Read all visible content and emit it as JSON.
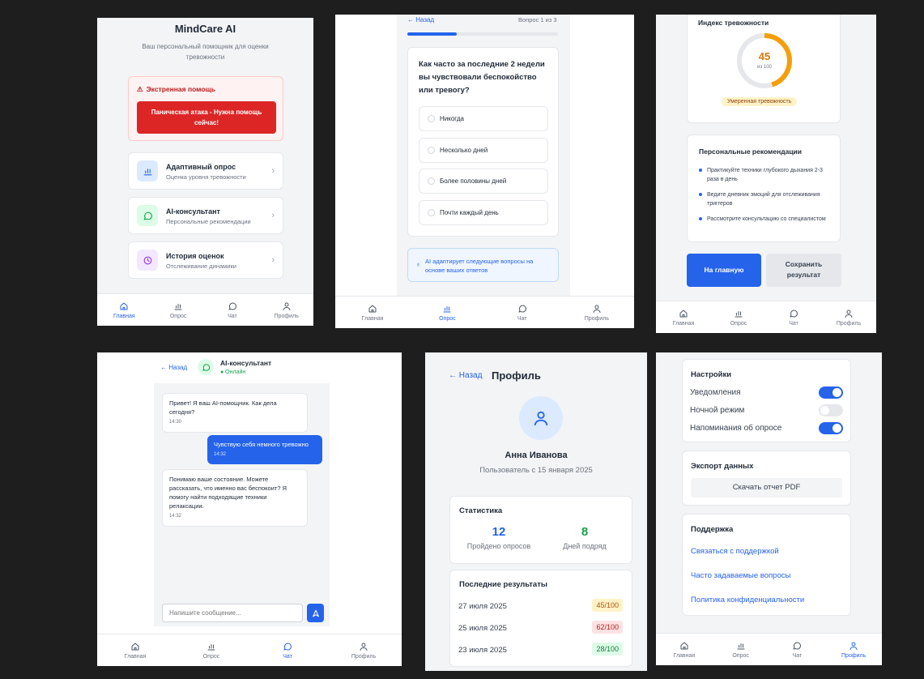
{
  "nav": [
    "Главная",
    "Опрос",
    "Чат",
    "Профиль"
  ],
  "home": {
    "title": "MindCare AI",
    "subtitle": "Ваш персональный помощник для оценки тревожности",
    "emergency_title": "Экстренная помощь",
    "emergency_button": "Паническая атака - Нужна помощь сейчас!",
    "menu": [
      {
        "title": "Адаптивный опрос",
        "sub": "Оценка уровня тревожности",
        "icon": "bar-chart-icon"
      },
      {
        "title": "AI-консультант",
        "sub": "Персональные рекомендации",
        "icon": "chat-icon"
      },
      {
        "title": "История оценок",
        "sub": "Отслеживание динамики",
        "icon": "clock-icon"
      }
    ]
  },
  "survey": {
    "back": "← Назад",
    "counter": "Вопрос 1 из 3",
    "progress": 0.33,
    "question": "Как часто за последние 2 недели вы чувствовали беспокойство или тревогу?",
    "options": [
      "Никогда",
      "Несколько дней",
      "Более половины дней",
      "Почти каждый день"
    ],
    "ai_note": "AI адаптирует следующие вопросы на основе ваших ответов"
  },
  "results": {
    "index_title": "Индекс тревожности",
    "score": "45",
    "score_max": "из 100",
    "score_fraction": 0.45,
    "level": "Умеренная тревожность",
    "rec_title": "Персональные рекомендации",
    "recommendations": [
      "Практикуйте техники глубокого дыхания 2-3 раза в день",
      "Ведите дневник эмоций для отслеживания триггеров",
      "Рассмотрите консультацию со специалистом"
    ],
    "home_button": "На главную",
    "save_button": "Сохранить результат"
  },
  "chat": {
    "back": "← Назад",
    "title": "AI-консультант",
    "status": "● Онлайн",
    "messages": [
      {
        "text": "Привет! Я ваш AI-помощник. Как дела сегодня?",
        "time": "14:30"
      },
      {
        "text": "Чувствую себя немного тревожно",
        "time": "14:32"
      },
      {
        "text": "Понимаю ваше состояние. Можете рассказать, что именно вас беспокоит? Я помогу найти подходящие техники релаксации.",
        "time": "14:32"
      }
    ],
    "input_placeholder": "Напишите сообщение..."
  },
  "profile": {
    "back": "← Назад",
    "title": "Профиль",
    "name": "Анна Иванова",
    "since": "Пользователь с 15 января 2025",
    "stats_title": "Статистика",
    "stat1_value": "12",
    "stat1_label": "Пройдено опросов",
    "stat2_value": "8",
    "stat2_label": "Дней подряд",
    "recent_title": "Последние результаты",
    "recent": [
      {
        "date": "27 июля 2025",
        "score": "45/100",
        "color": "#fef3c7",
        "text": "#b45309"
      },
      {
        "date": "25 июля 2025",
        "score": "62/100",
        "color": "#fee2e2",
        "text": "#b91c1c"
      },
      {
        "date": "23 июля 2025",
        "score": "28/100",
        "color": "#dcfce7",
        "text": "#15803d"
      }
    ]
  },
  "settings": {
    "title": "Настройки",
    "toggles": [
      {
        "label": "Уведомления",
        "on": true
      },
      {
        "label": "Ночной режим",
        "on": false
      },
      {
        "label": "Напоминания об опросе",
        "on": true
      }
    ],
    "export_title": "Экспорт данных",
    "export_button": "Скачать отчет PDF",
    "support_title": "Поддержка",
    "links": [
      "Связаться с поддержкой",
      "Часто задаваемые вопросы",
      "Политика конфиденциальности"
    ]
  },
  "colors": {
    "accent": "#2563eb",
    "danger": "#dc2626",
    "success": "#16a34a",
    "warning": "#f59e0b"
  }
}
